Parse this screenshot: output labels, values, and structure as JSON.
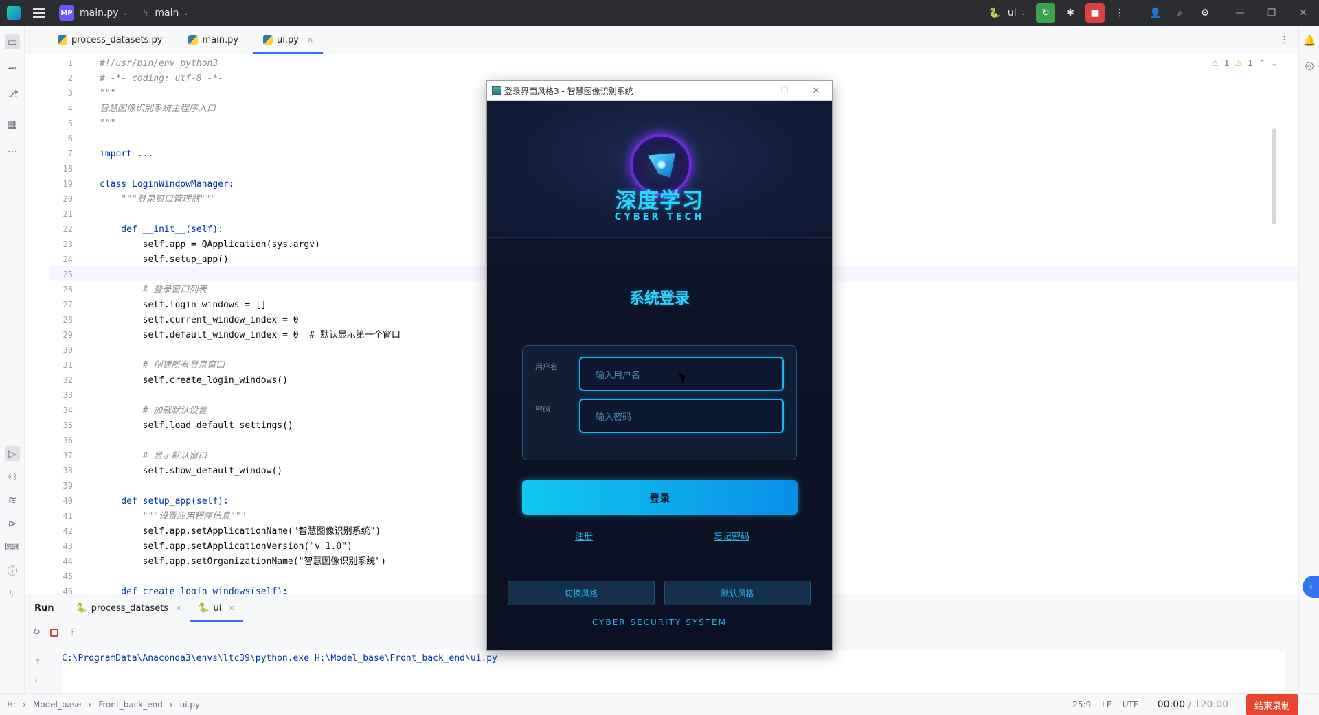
{
  "titlebar": {
    "project_badge": "MP",
    "project_file": "main.py",
    "branch": "main",
    "run_config": "ui"
  },
  "tabs": [
    {
      "label": "process_datasets.py"
    },
    {
      "label": "main.py"
    },
    {
      "label": "ui.py"
    }
  ],
  "inspections": {
    "warnings_a": "1",
    "warnings_b": "1"
  },
  "editor": {
    "lines": [
      {
        "n": "1",
        "t": "#!/usr/bin/env python3"
      },
      {
        "n": "2",
        "t": "# -*- coding: utf-8 -*-"
      },
      {
        "n": "3",
        "t": "\"\"\""
      },
      {
        "n": "4",
        "t": "智慧图像识别系统主程序入口"
      },
      {
        "n": "5",
        "t": "\"\"\""
      },
      {
        "n": "6",
        "t": ""
      },
      {
        "n": "7",
        "t": "import ..."
      },
      {
        "n": "18",
        "t": ""
      },
      {
        "n": "19",
        "t": "class LoginWindowManager:"
      },
      {
        "n": "20",
        "t": "    \"\"\"登录窗口管理器\"\"\""
      },
      {
        "n": "21",
        "t": ""
      },
      {
        "n": "22",
        "t": "    def __init__(self):"
      },
      {
        "n": "23",
        "t": "        self.app = QApplication(sys.argv)"
      },
      {
        "n": "24",
        "t": "        self.setup_app()"
      },
      {
        "n": "25",
        "t": ""
      },
      {
        "n": "26",
        "t": "        # 登录窗口列表"
      },
      {
        "n": "27",
        "t": "        self.login_windows = []"
      },
      {
        "n": "28",
        "t": "        self.current_window_index = 0"
      },
      {
        "n": "29",
        "t": "        self.default_window_index = 0  # 默认显示第一个窗口"
      },
      {
        "n": "30",
        "t": ""
      },
      {
        "n": "31",
        "t": "        # 创建所有登录窗口"
      },
      {
        "n": "32",
        "t": "        self.create_login_windows()"
      },
      {
        "n": "33",
        "t": ""
      },
      {
        "n": "34",
        "t": "        # 加载默认设置"
      },
      {
        "n": "35",
        "t": "        self.load_default_settings()"
      },
      {
        "n": "36",
        "t": ""
      },
      {
        "n": "37",
        "t": "        # 显示默认窗口"
      },
      {
        "n": "38",
        "t": "        self.show_default_window()"
      },
      {
        "n": "39",
        "t": ""
      },
      {
        "n": "40",
        "t": "    def setup_app(self):"
      },
      {
        "n": "41",
        "t": "        \"\"\"设置应用程序信息\"\"\""
      },
      {
        "n": "42",
        "t": "        self.app.setApplicationName(\"智慧图像识别系统\")"
      },
      {
        "n": "43",
        "t": "        self.app.setApplicationVersion(\"v 1.0\")"
      },
      {
        "n": "44",
        "t": "        self.app.setOrganizationName(\"智慧图像识别系统\")"
      },
      {
        "n": "45",
        "t": ""
      },
      {
        "n": "46",
        "t": "    def create_login_windows(self):"
      }
    ]
  },
  "run_panel": {
    "title": "Run",
    "tabs": [
      {
        "label": "process_datasets"
      },
      {
        "label": "ui"
      }
    ],
    "console": "C:\\ProgramData\\Anaconda3\\envs\\ltc39\\python.exe H:\\Model_base\\Front_back_end\\ui.py"
  },
  "statusbar": {
    "crumbs": [
      "H:",
      "Model_base",
      "Front_back_end",
      "ui.py"
    ],
    "position": "25:9",
    "line_sep": "LF",
    "encoding": "UTF",
    "rec_time": "00:00",
    "rec_total": "/ 120:00",
    "rec_button": "结束录制"
  },
  "login_window": {
    "title": "登录界面风格3 - 智慧图像识别系统",
    "logo_text": "深度学习",
    "logo_sub": "CYBER TECH",
    "heading": "系统登录",
    "username_label": "用户名",
    "username_placeholder": "输入用户名",
    "password_label": "密码",
    "password_placeholder": "输入密码",
    "login_button": "登录",
    "register_link": "注册",
    "forgot_link": "忘记密码",
    "switch_style_button": "切换风格",
    "default_style_button": "默认风格",
    "footer": "CYBER SECURITY SYSTEM"
  }
}
